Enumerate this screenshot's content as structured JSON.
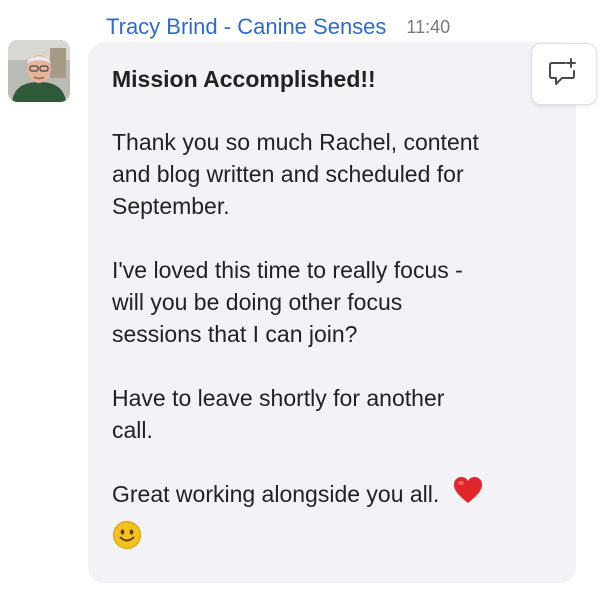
{
  "message": {
    "sender_name": "Tracy Brind - Canine Senses",
    "timestamp": "11:40",
    "heading": "Mission Accomplished!!",
    "paragraphs": [
      [
        "Thank you so much Rachel, content",
        "and blog written and scheduled for",
        "September."
      ],
      [
        "I've loved this time to really focus -",
        "will you be doing other focus",
        "sessions that I can join?"
      ],
      [
        "Have to leave shortly for another",
        "call."
      ],
      [
        "Great working alongside you all."
      ]
    ],
    "emojis": [
      "heart-emoji",
      "slightly-smiling-face-emoji"
    ]
  },
  "colors": {
    "sender_name": "#2d6ad6",
    "timestamp": "#7a7a7a",
    "bubble_bg": "#f2f2f7",
    "text": "#222222",
    "heart": "#e0252b",
    "smile": "#f5c21b"
  },
  "actions": {
    "reply_in_thread_icon": "comment-plus-icon"
  }
}
